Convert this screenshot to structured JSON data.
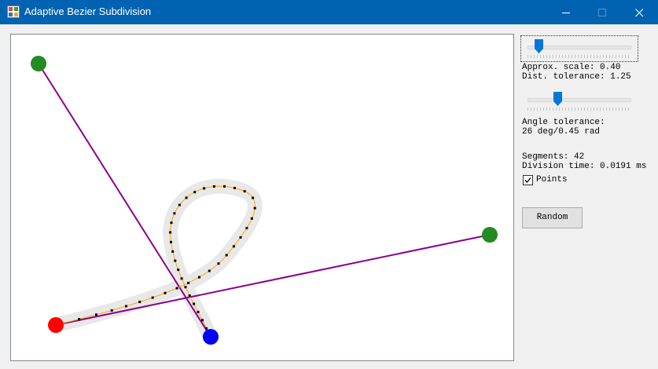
{
  "window": {
    "title": "Adaptive Bezier Subdivision"
  },
  "colors": {
    "titlebar": "#0063b1",
    "control_line": "#8b008b",
    "curve": "#ffa500",
    "curve_halo": "#e8e8e8",
    "start_point": "#ff0000",
    "end_point": "#0000ff",
    "control_points": "#228b22"
  },
  "panel": {
    "approx_scale_slider": {
      "value": 0.4
    },
    "approx_text": "Approx. scale: 0.40\nDist. tolerance: 1.25",
    "angle_slider": {
      "value_deg": 26
    },
    "angle_text": "Angle tolerance:\n26 deg/0.45 rad",
    "stats_text": "Segments: 42\nDivision time: 0.0191 ms",
    "points_checkbox": {
      "label": "Points",
      "checked": true
    },
    "random_button": {
      "label": "Random"
    }
  }
}
